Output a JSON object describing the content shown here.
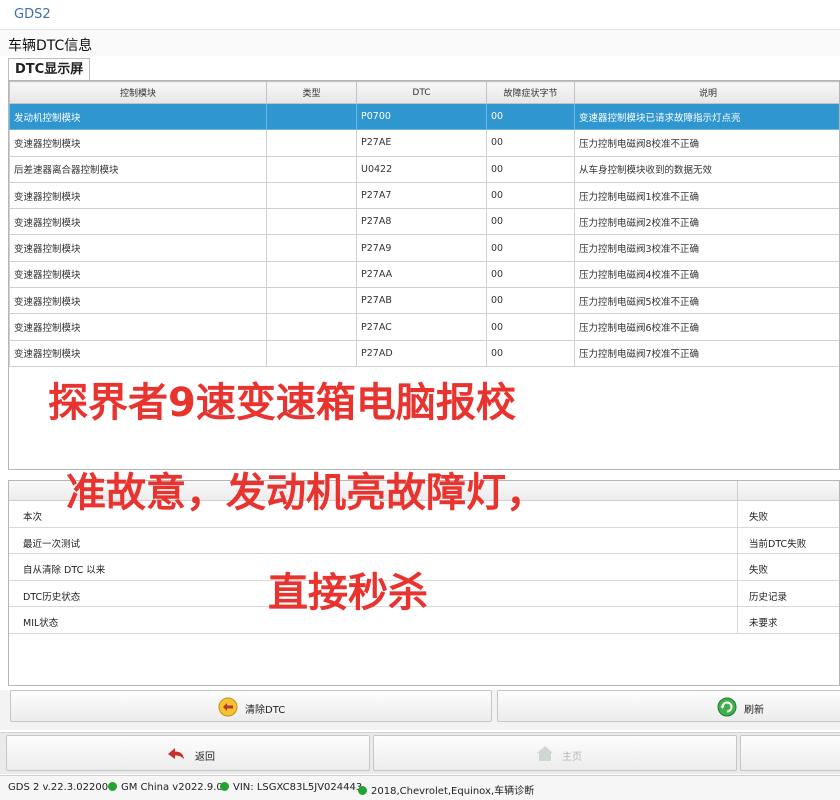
{
  "window": {
    "app_title": "GDS2"
  },
  "page": {
    "title": "车辆DTC信息",
    "section_tab": "DTC显示屏"
  },
  "dtc_table": {
    "columns": [
      "控制模块",
      "类型",
      "DTC",
      "故障症状字节",
      "说明"
    ],
    "rows": [
      {
        "module": "发动机控制模块",
        "type": "",
        "dtc": "P0700",
        "symptom": "00",
        "desc": "变速器控制模块已请求故障指示灯点亮",
        "selected": true
      },
      {
        "module": "变速器控制模块",
        "type": "",
        "dtc": "P27AE",
        "symptom": "00",
        "desc": "压力控制电磁阀8校准不正确"
      },
      {
        "module": "后差速器离合器控制模块",
        "type": "",
        "dtc": "U0422",
        "symptom": "00",
        "desc": "从车身控制模块收到的数据无效"
      },
      {
        "module": "变速器控制模块",
        "type": "",
        "dtc": "P27A7",
        "symptom": "00",
        "desc": "压力控制电磁阀1校准不正确"
      },
      {
        "module": "变速器控制模块",
        "type": "",
        "dtc": "P27A8",
        "symptom": "00",
        "desc": "压力控制电磁阀2校准不正确"
      },
      {
        "module": "变速器控制模块",
        "type": "",
        "dtc": "P27A9",
        "symptom": "00",
        "desc": "压力控制电磁阀3校准不正确"
      },
      {
        "module": "变速器控制模块",
        "type": "",
        "dtc": "P27AA",
        "symptom": "00",
        "desc": "压力控制电磁阀4校准不正确"
      },
      {
        "module": "变速器控制模块",
        "type": "",
        "dtc": "P27AB",
        "symptom": "00",
        "desc": "压力控制电磁阀5校准不正确"
      },
      {
        "module": "变速器控制模块",
        "type": "",
        "dtc": "P27AC",
        "symptom": "00",
        "desc": "压力控制电磁阀6校准不正确"
      },
      {
        "module": "变速器控制模块",
        "type": "",
        "dtc": "P27AD",
        "symptom": "00",
        "desc": "压力控制电磁阀7校准不正确"
      }
    ]
  },
  "status_table": {
    "rows": [
      {
        "label": "本次",
        "value": "失败"
      },
      {
        "label": "最近一次测试",
        "value": "当前DTC失败"
      },
      {
        "label": "自从清除 DTC 以来",
        "value": "失败"
      },
      {
        "label": "DTC历史状态",
        "value": "历史记录"
      },
      {
        "label": "MIL状态",
        "value": "未要求"
      }
    ]
  },
  "overlay_text": {
    "line1": "探界者9速变速箱电脑报校",
    "line2": "准故意，发动机亮故障灯，",
    "line3": "直接秒杀",
    "color": "#e8332f"
  },
  "buttons": {
    "clear_dtc": "清除DTC",
    "refresh": "刷新",
    "back": "返回",
    "home": "主页"
  },
  "statusbar": {
    "version": "GDS 2 v.22.3.02200",
    "database": "GM China v2022.9.0",
    "vin": "VIN: LSGXC83L5JV024443",
    "vehicle": "2018,Chevrolet,Equinox,车辆诊断",
    "indicator_color": "#21a335"
  },
  "colors": {
    "selection": "#2f96cf",
    "app_title": "#3f6ea8"
  }
}
